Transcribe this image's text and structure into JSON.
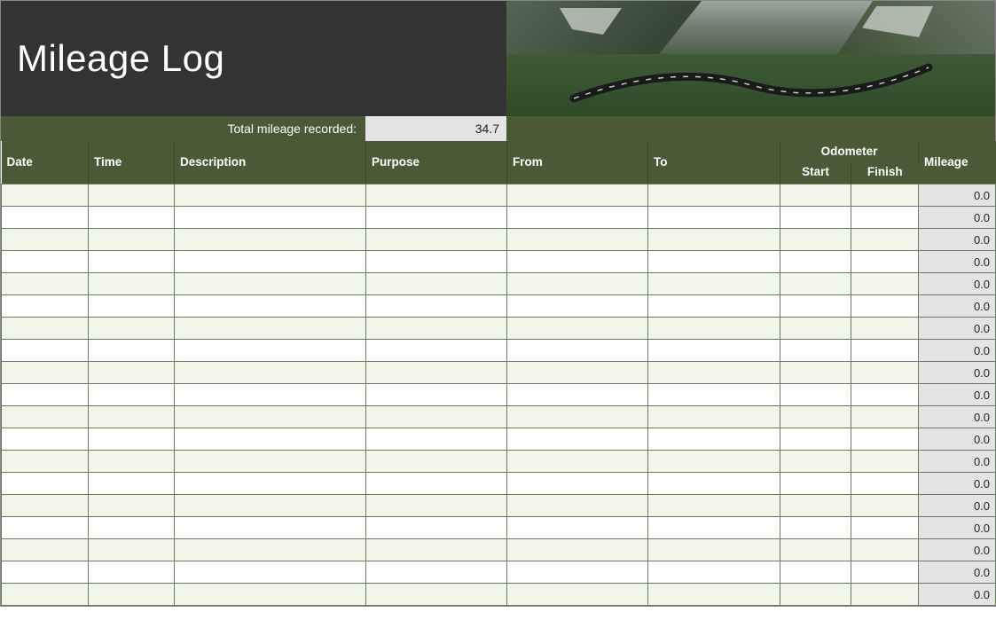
{
  "header": {
    "title": "Mileage Log"
  },
  "summary": {
    "label": "Total mileage recorded:",
    "value": "34.7"
  },
  "columns": {
    "date": "Date",
    "time": "Time",
    "description": "Description",
    "purpose": "Purpose",
    "from": "From",
    "to": "To",
    "odometer_group": "Odometer",
    "odometer_start": "Start",
    "odometer_finish": "Finish",
    "mileage": "Mileage"
  },
  "rows": [
    {
      "date": "",
      "time": "",
      "description": "",
      "purpose": "",
      "from": "",
      "to": "",
      "ostart": "",
      "ofinish": "",
      "mileage": "0.0"
    },
    {
      "date": "",
      "time": "",
      "description": "",
      "purpose": "",
      "from": "",
      "to": "",
      "ostart": "",
      "ofinish": "",
      "mileage": "0.0"
    },
    {
      "date": "",
      "time": "",
      "description": "",
      "purpose": "",
      "from": "",
      "to": "",
      "ostart": "",
      "ofinish": "",
      "mileage": "0.0"
    },
    {
      "date": "",
      "time": "",
      "description": "",
      "purpose": "",
      "from": "",
      "to": "",
      "ostart": "",
      "ofinish": "",
      "mileage": "0.0"
    },
    {
      "date": "",
      "time": "",
      "description": "",
      "purpose": "",
      "from": "",
      "to": "",
      "ostart": "",
      "ofinish": "",
      "mileage": "0.0"
    },
    {
      "date": "",
      "time": "",
      "description": "",
      "purpose": "",
      "from": "",
      "to": "",
      "ostart": "",
      "ofinish": "",
      "mileage": "0.0"
    },
    {
      "date": "",
      "time": "",
      "description": "",
      "purpose": "",
      "from": "",
      "to": "",
      "ostart": "",
      "ofinish": "",
      "mileage": "0.0"
    },
    {
      "date": "",
      "time": "",
      "description": "",
      "purpose": "",
      "from": "",
      "to": "",
      "ostart": "",
      "ofinish": "",
      "mileage": "0.0"
    },
    {
      "date": "",
      "time": "",
      "description": "",
      "purpose": "",
      "from": "",
      "to": "",
      "ostart": "",
      "ofinish": "",
      "mileage": "0.0"
    },
    {
      "date": "",
      "time": "",
      "description": "",
      "purpose": "",
      "from": "",
      "to": "",
      "ostart": "",
      "ofinish": "",
      "mileage": "0.0"
    },
    {
      "date": "",
      "time": "",
      "description": "",
      "purpose": "",
      "from": "",
      "to": "",
      "ostart": "",
      "ofinish": "",
      "mileage": "0.0"
    },
    {
      "date": "",
      "time": "",
      "description": "",
      "purpose": "",
      "from": "",
      "to": "",
      "ostart": "",
      "ofinish": "",
      "mileage": "0.0"
    },
    {
      "date": "",
      "time": "",
      "description": "",
      "purpose": "",
      "from": "",
      "to": "",
      "ostart": "",
      "ofinish": "",
      "mileage": "0.0"
    },
    {
      "date": "",
      "time": "",
      "description": "",
      "purpose": "",
      "from": "",
      "to": "",
      "ostart": "",
      "ofinish": "",
      "mileage": "0.0"
    },
    {
      "date": "",
      "time": "",
      "description": "",
      "purpose": "",
      "from": "",
      "to": "",
      "ostart": "",
      "ofinish": "",
      "mileage": "0.0"
    },
    {
      "date": "",
      "time": "",
      "description": "",
      "purpose": "",
      "from": "",
      "to": "",
      "ostart": "",
      "ofinish": "",
      "mileage": "0.0"
    },
    {
      "date": "",
      "time": "",
      "description": "",
      "purpose": "",
      "from": "",
      "to": "",
      "ostart": "",
      "ofinish": "",
      "mileage": "0.0"
    },
    {
      "date": "",
      "time": "",
      "description": "",
      "purpose": "",
      "from": "",
      "to": "",
      "ostart": "",
      "ofinish": "",
      "mileage": "0.0"
    },
    {
      "date": "",
      "time": "",
      "description": "",
      "purpose": "",
      "from": "",
      "to": "",
      "ostart": "",
      "ofinish": "",
      "mileage": "0.0"
    }
  ]
}
